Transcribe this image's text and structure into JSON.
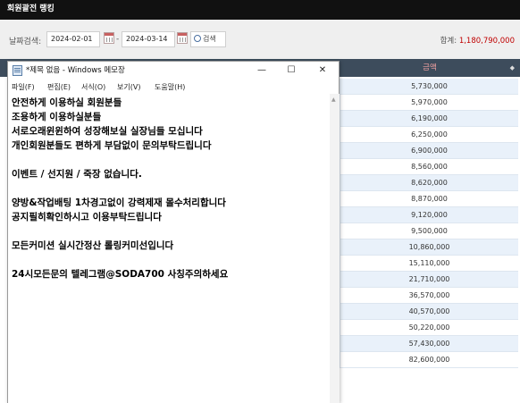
{
  "app": {
    "title": "회원괄전 랭킹"
  },
  "filter": {
    "label": "날짜검색:",
    "start_date": "2024-02-01",
    "end_date": "2024-03-14",
    "separator": "-",
    "search_label": "검색",
    "total_label": "합계:",
    "total_value": "1,180,790,000"
  },
  "table": {
    "column_amount": "금액",
    "sort_icon": "◆",
    "amounts": [
      "5,730,000",
      "5,970,000",
      "6,190,000",
      "6,250,000",
      "6,900,000",
      "8,560,000",
      "8,620,000",
      "8,870,000",
      "9,120,000",
      "9,500,000",
      "10,860,000",
      "15,110,000",
      "21,710,000",
      "36,570,000",
      "40,570,000",
      "50,220,000",
      "57,430,000",
      "82,600,000"
    ]
  },
  "notepad": {
    "title": "*제목 없음 - Windows 메모장",
    "menu": [
      "파일(F)",
      "편집(E)",
      "서식(O)",
      "보기(V)",
      "도움말(H)"
    ],
    "min_icon": "—",
    "max_icon": "☐",
    "close_icon": "✕",
    "lines": [
      "안전하게 이용하실 회원분들",
      "조용하게 이용하실분들",
      "서로오래윈윈하여 성장해보실 실장님들 모십니다",
      "개인회원분들도 편하게 부담없이 문의부탁드립니다",
      "",
      "이벤트 / 선지원 / 죽장 없습니다.",
      "",
      "양방&작업배팅 1차경고없이 강력제재 몰수처리합니다",
      "공지필히확인하시고 이용부탁드립니다",
      "",
      "모든커미션 실시간정산 롤링커미선입니다",
      "",
      "24시모든문의 텔레그램@SODA700 사칭주의하세요"
    ]
  },
  "colors": {
    "total_amount": "#c00000",
    "header_bg": "#3d4c5c",
    "amount_header": "#f0a0a0"
  }
}
